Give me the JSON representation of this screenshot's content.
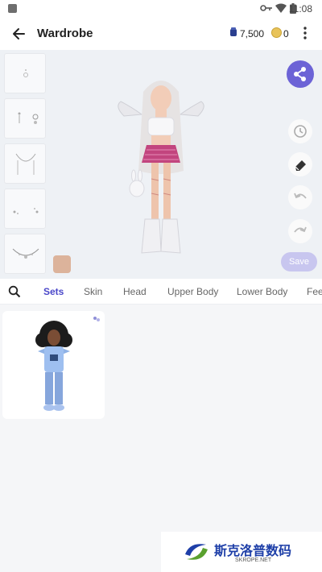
{
  "status_bar": {
    "time": "11:08"
  },
  "app_bar": {
    "title": "Wardrobe",
    "gems": "7,500",
    "coins": "0"
  },
  "stage": {
    "save_label": "Save",
    "skin_tone_color": "#dcb39b"
  },
  "tabs": [
    {
      "label": "Sets",
      "active": true
    },
    {
      "label": "Skin"
    },
    {
      "label": "Head"
    },
    {
      "label": "Upper Body"
    },
    {
      "label": "Lower Body"
    },
    {
      "label": "Fee"
    }
  ],
  "watermark": {
    "text": "斯克洛普数码",
    "sub": "SKROPE.NET"
  },
  "colors": {
    "accent": "#4a47c9",
    "share": "#6c63d6",
    "save_disabled": "#c8c6ef"
  },
  "icons": [
    "back-arrow-icon",
    "gem-icon",
    "coin-icon",
    "more-vert-icon",
    "share-icon",
    "history-icon",
    "eraser-icon",
    "undo-icon",
    "redo-icon",
    "search-icon",
    "wifi-icon",
    "battery-icon",
    "key-icon"
  ]
}
